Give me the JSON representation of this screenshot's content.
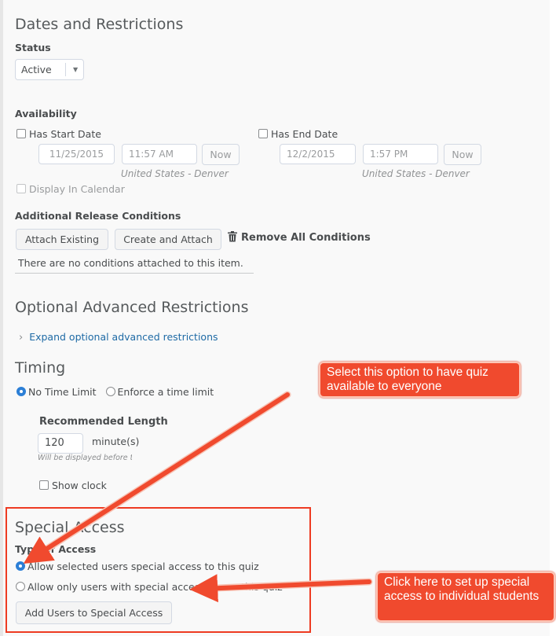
{
  "dates_section": {
    "title": "Dates and Restrictions",
    "status_label": "Status",
    "status_value": "Active",
    "availability_label": "Availability",
    "start": {
      "checkbox_label": "Has Start Date",
      "date": "11/25/2015",
      "time": "11:57 AM",
      "now": "Now",
      "timezone": "United States - Denver"
    },
    "end": {
      "checkbox_label": "Has End Date",
      "date": "12/2/2015",
      "time": "1:57 PM",
      "now": "Now",
      "timezone": "United States - Denver"
    },
    "display_in_calendar": "Display In Calendar"
  },
  "release_conditions": {
    "label": "Additional Release Conditions",
    "attach_existing": "Attach Existing",
    "create_and_attach": "Create and Attach",
    "remove_all": "Remove All Conditions",
    "empty_message": "There are no conditions attached to this item."
  },
  "advanced": {
    "title": "Optional Advanced Restrictions",
    "expand_link": "Expand optional advanced restrictions"
  },
  "timing": {
    "title": "Timing",
    "no_limit": "No Time Limit",
    "enforce": "Enforce a time limit",
    "recommended_label": "Recommended Length",
    "length_value": "120",
    "unit": "minute(s)",
    "hint": "Will be displayed before the quiz starts",
    "show_clock": "Show clock"
  },
  "special_access": {
    "title": "Special Access",
    "type_label": "Type of Access",
    "option_allow_selected": "Allow selected users special access to this quiz",
    "option_allow_only": "Allow only users with special access to see this quiz",
    "add_button": "Add Users to Special Access"
  },
  "annotations": {
    "callout_top": "Select this option to have quiz available to everyone",
    "callout_bottom": "Click here to set up special access to individual students",
    "color": "#f04a2e"
  }
}
